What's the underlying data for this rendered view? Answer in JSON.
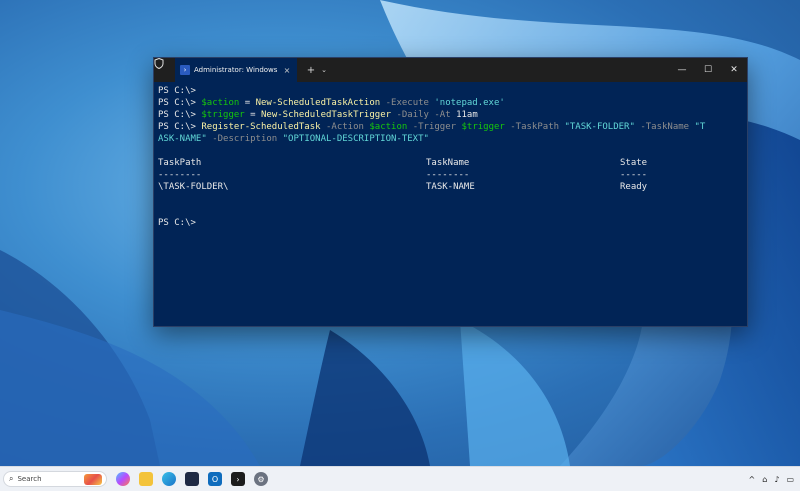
{
  "window": {
    "tab_title": "Administrator: Windows Pow",
    "tab_close": "×",
    "new_tab": "+",
    "dropdown": "⌄",
    "minimize": "—",
    "maximize": "☐",
    "close": "✕"
  },
  "terminal": {
    "prompt": "PS C:\\>",
    "line2": {
      "var": "$action",
      "op": " = ",
      "cmd": "New-ScheduledTaskAction",
      "param": " -Execute ",
      "str": "'notepad.exe'"
    },
    "line3": {
      "var": "$trigger",
      "op": " = ",
      "cmd": "New-ScheduledTaskTrigger",
      "param1": " -Daily",
      "param2": " -At ",
      "value": "11am"
    },
    "line4": {
      "cmd": "Register-ScheduledTask",
      "p1": " -Action ",
      "v1": "$action",
      "p2": " -Trigger ",
      "v2": "$trigger",
      "p3": " -TaskPath ",
      "s1": "\"TASK-FOLDER\"",
      "p4": " -TaskName ",
      "s2a": "\"T",
      "s2b": "ASK-NAME\"",
      "p5": " -Description ",
      "s3": "\"OPTIONAL-DESCRIPTION-TEXT\""
    },
    "table": {
      "headers": [
        "TaskPath",
        "TaskName",
        "State"
      ],
      "dashes": [
        "--------",
        "--------",
        "-----"
      ],
      "row": [
        "\\TASK-FOLDER\\",
        "TASK-NAME",
        "Ready"
      ]
    }
  },
  "taskbar": {
    "search_label": "Search",
    "tray_chevron": "^",
    "tray_network": "⌂",
    "tray_volume": "♪",
    "tray_battery": "▭"
  },
  "icons": {
    "shield": "shield-icon",
    "powershell": "powershell-icon",
    "search": "search-icon"
  }
}
